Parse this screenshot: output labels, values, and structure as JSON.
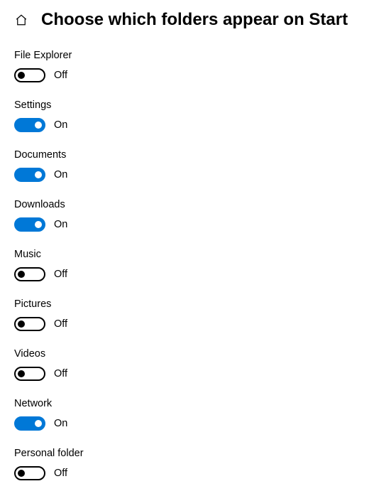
{
  "header": {
    "title": "Choose which folders appear on Start"
  },
  "state_labels": {
    "on": "On",
    "off": "Off"
  },
  "settings": [
    {
      "id": "file-explorer",
      "label": "File Explorer",
      "on": false
    },
    {
      "id": "settings",
      "label": "Settings",
      "on": true
    },
    {
      "id": "documents",
      "label": "Documents",
      "on": true
    },
    {
      "id": "downloads",
      "label": "Downloads",
      "on": true
    },
    {
      "id": "music",
      "label": "Music",
      "on": false
    },
    {
      "id": "pictures",
      "label": "Pictures",
      "on": false
    },
    {
      "id": "videos",
      "label": "Videos",
      "on": false
    },
    {
      "id": "network",
      "label": "Network",
      "on": true
    },
    {
      "id": "personal-folder",
      "label": "Personal folder",
      "on": false
    }
  ]
}
